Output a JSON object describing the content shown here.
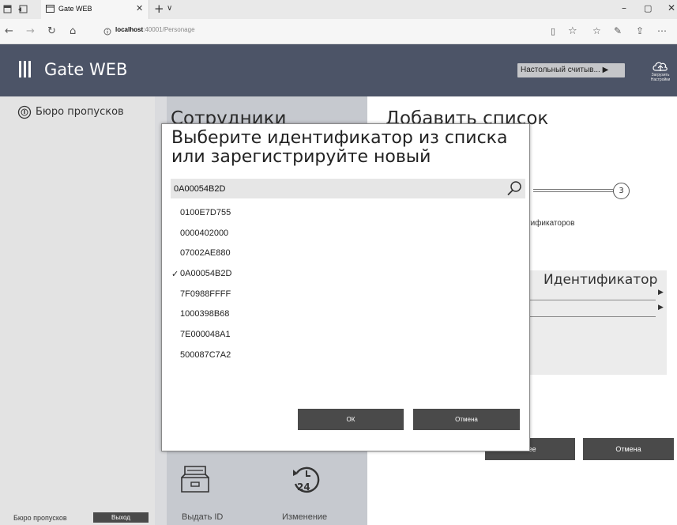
{
  "browser": {
    "tab_title": "Gate WEB",
    "url_host": "localhost",
    "url_rest": ":40001/Personage"
  },
  "header": {
    "app_name": "Gate WEB",
    "reader_select": "Настольный считыв... ▶",
    "upload_line1": "Загрузить",
    "upload_line2": "Настройки"
  },
  "sidebar": {
    "item_label": "Бюро пропусков",
    "footer_label": "Бюро пропусков",
    "logout_label": "Выход"
  },
  "middle": {
    "title": "Сотрудники",
    "issue_id_label": "Выдать ID",
    "history_label": "Изменение",
    "history_badge": "24"
  },
  "right": {
    "title": "Добавить список",
    "step3": "3",
    "subtitle": "тификаторов",
    "column_header": "Идентификатор",
    "next_label": "лее",
    "cancel_label": "Отмена"
  },
  "modal": {
    "title": "Выберите идентификатор из списка или зарегистрируйте новый",
    "search_value": "0A00054B2D",
    "selected_id": "0A00054B2D",
    "ids": [
      "0100E7D755",
      "0000402000",
      "07002AE880",
      "0A00054B2D",
      "7F0988FFFF",
      "1000398B68",
      "7E000048A1",
      "500087C7A2"
    ],
    "ok_label": "ОК",
    "cancel_label": "Отмена"
  },
  "colors": {
    "header_bg": "#4c5467",
    "sidebar_bg": "#e3e3e3",
    "button_dark": "#4a4a4a"
  }
}
